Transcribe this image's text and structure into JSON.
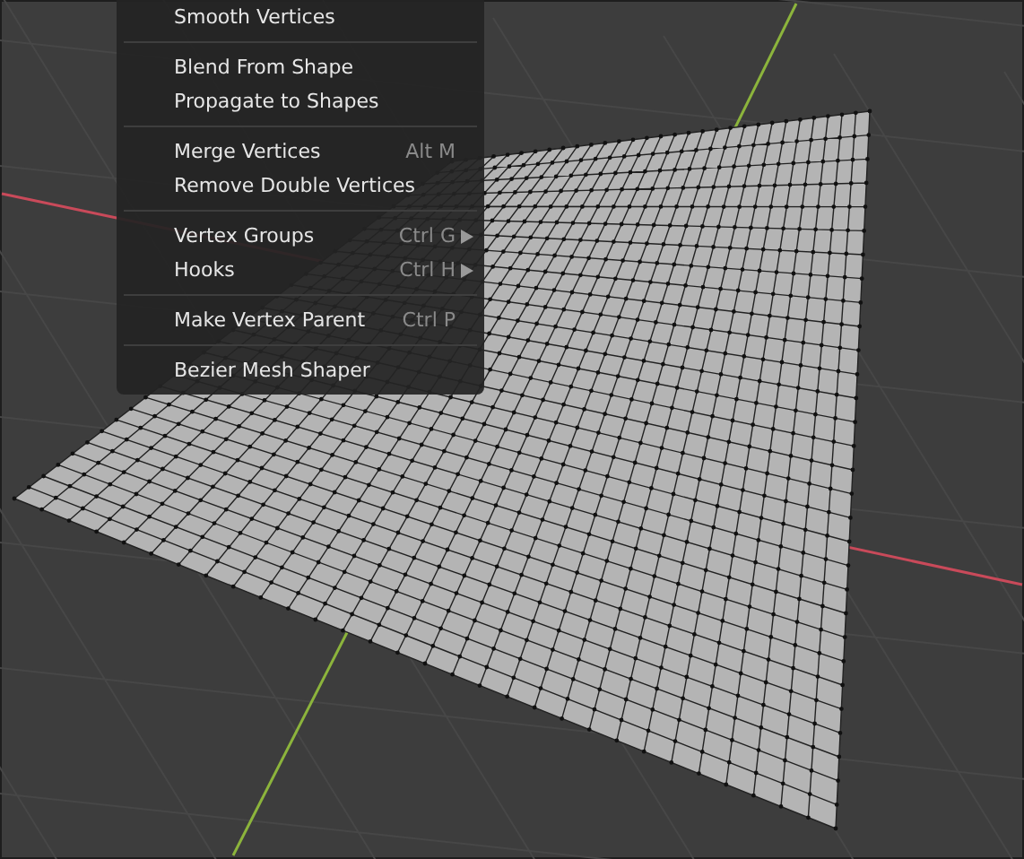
{
  "menu": {
    "sections": [
      [
        {
          "label": "Smooth Vertices",
          "has_submenu": false
        }
      ],
      [
        {
          "label": "Blend From Shape",
          "has_submenu": false
        },
        {
          "label": "Propagate to Shapes",
          "has_submenu": false
        }
      ],
      [
        {
          "label": "Merge Vertices",
          "shortcut": "Alt M",
          "has_submenu": false
        },
        {
          "label": "Remove Double Vertices",
          "has_submenu": false
        }
      ],
      [
        {
          "label": "Vertex Groups",
          "shortcut": "Ctrl G",
          "has_submenu": true
        },
        {
          "label": "Hooks",
          "shortcut": "Ctrl H",
          "has_submenu": true
        }
      ],
      [
        {
          "label": "Make Vertex Parent",
          "shortcut": "Ctrl P",
          "has_submenu": false
        }
      ],
      [
        {
          "label": "Bezier Mesh Shaper",
          "has_submenu": false
        }
      ]
    ]
  }
}
